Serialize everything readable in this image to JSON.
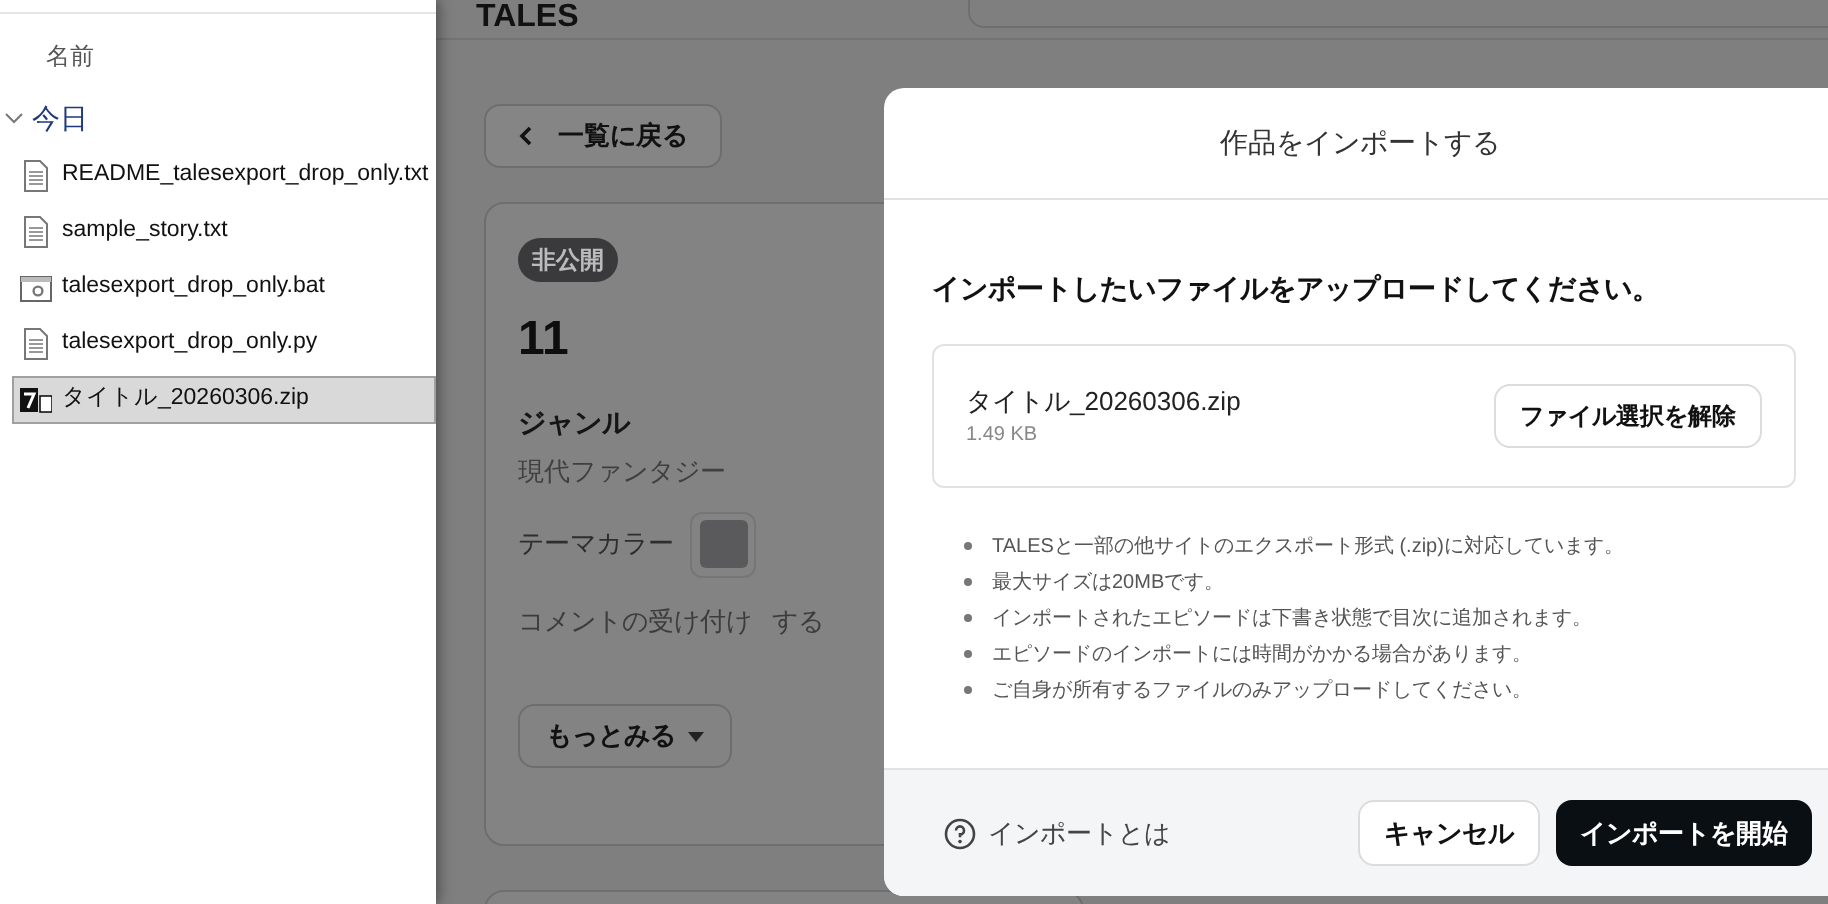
{
  "explorer": {
    "column_header": "名前",
    "group": {
      "label": "今日",
      "expanded": true,
      "files": [
        {
          "name": "README_talesexport_drop_only.txt",
          "kind": "text",
          "selected": false
        },
        {
          "name": "sample_story.txt",
          "kind": "text",
          "selected": false
        },
        {
          "name": "talesexport_drop_only.bat",
          "kind": "batch",
          "selected": false
        },
        {
          "name": "talesexport_drop_only.py",
          "kind": "text",
          "selected": false
        },
        {
          "name": "タイトル_20260306.zip",
          "kind": "archive",
          "selected": true
        }
      ]
    }
  },
  "page": {
    "logo": "TALES",
    "back_button": "一覧に戻る",
    "work": {
      "status_badge": "非公開",
      "title": "11",
      "genre_label": "ジャンル",
      "genre": "現代ファンタジー",
      "theme_color_label": "テーマカラー",
      "comments_label": "コメントの受け付け",
      "comments_value": "する",
      "more_button": "もっとみる"
    }
  },
  "dialog": {
    "title": "作品をインポートする",
    "heading": "インポートしたいファイルをアップロードしてください。",
    "file": {
      "name": "タイトル_20260306.zip",
      "size": "1.49 KB",
      "clear_button": "ファイル選択を解除"
    },
    "notes": [
      "TALESと一部の他サイトのエクスポート形式 (.zip)に対応しています。",
      "最大サイズは20MBです。",
      "インポートされたエピソードは下書き状態で目次に追加されます。",
      "エピソードのインポートには時間がかかる場合があります。",
      "ご自身が所有するファイルのみアップロードしてください。"
    ],
    "help_link": "インポートとは",
    "cancel_button": "キャンセル",
    "start_button": "インポートを開始"
  }
}
